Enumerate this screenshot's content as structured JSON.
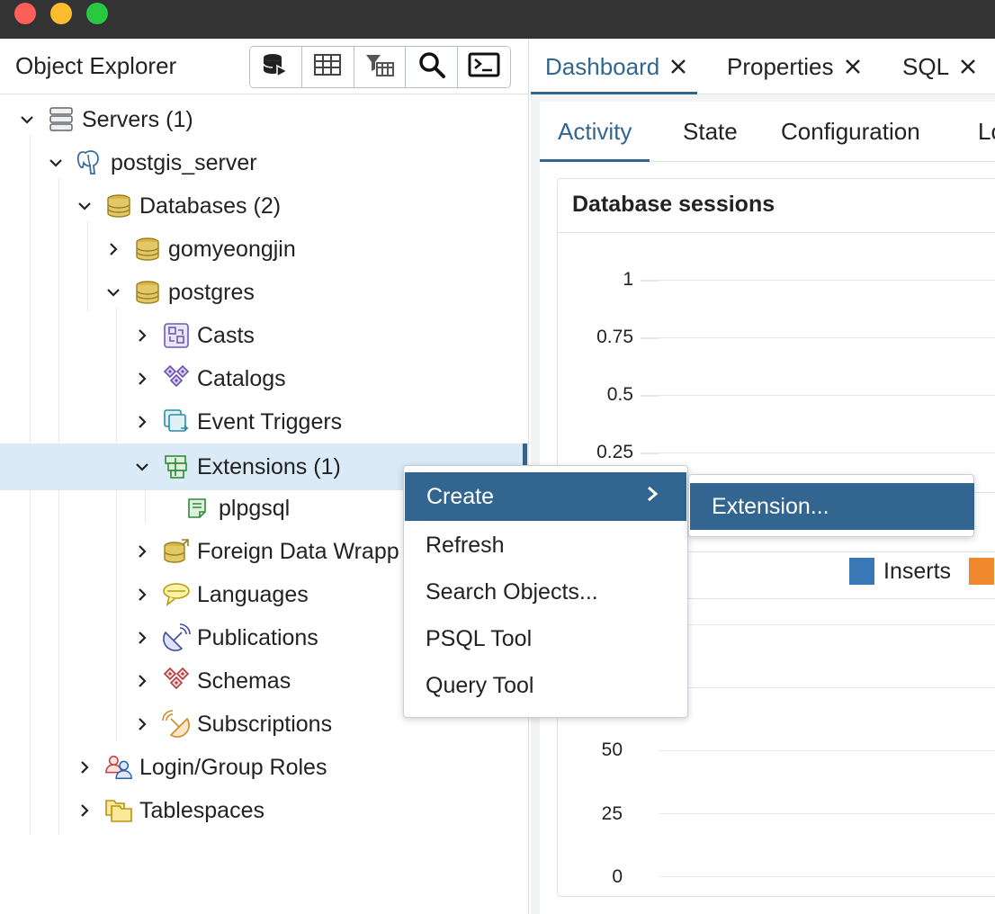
{
  "window": {
    "traffic_lights": [
      "close",
      "minimize",
      "zoom"
    ]
  },
  "explorer": {
    "title": "Object Explorer",
    "toolbar": [
      {
        "name": "query-tool-button",
        "icon": "database-play-icon"
      },
      {
        "name": "view-data-button",
        "icon": "table-icon"
      },
      {
        "name": "filtered-rows-button",
        "icon": "table-filter-icon"
      },
      {
        "name": "search-objects-button",
        "icon": "search-icon"
      },
      {
        "name": "psql-tool-button",
        "icon": "terminal-icon"
      }
    ],
    "tree": {
      "servers": {
        "label": "Servers",
        "count": "(1)"
      },
      "server": {
        "label": "postgis_server"
      },
      "databases": {
        "label": "Databases",
        "count": "(2)"
      },
      "db1": {
        "label": "gomyeongjin"
      },
      "db2": {
        "label": "postgres"
      },
      "casts": {
        "label": "Casts"
      },
      "catalogs": {
        "label": "Catalogs"
      },
      "event_triggers": {
        "label": "Event Triggers"
      },
      "extensions": {
        "label": "Extensions",
        "count": "(1)"
      },
      "plpgsql": {
        "label": "plpgsql"
      },
      "fdw": {
        "label": "Foreign Data Wrapp"
      },
      "languages": {
        "label": "Languages"
      },
      "publications": {
        "label": "Publications"
      },
      "schemas": {
        "label": "Schemas"
      },
      "subscriptions": {
        "label": "Subscriptions"
      },
      "login_roles": {
        "label": "Login/Group Roles"
      },
      "tablespaces": {
        "label": "Tablespaces"
      }
    }
  },
  "tabs": [
    {
      "label": "Dashboard",
      "active": true
    },
    {
      "label": "Properties",
      "active": false
    },
    {
      "label": "SQL",
      "active": false
    }
  ],
  "dashboard": {
    "subtabs": [
      "Activity",
      "State",
      "Configuration",
      "Lo"
    ],
    "sessions_card": {
      "title": "Database sessions",
      "yticks": [
        "1",
        "0.75",
        "0.5",
        "0.25"
      ]
    },
    "tuples_card": {
      "legend": [
        {
          "label": "Inserts",
          "color": "#3a78b5"
        },
        {
          "label": "",
          "color": "#f0882e"
        }
      ],
      "yticks": [
        "50",
        "25",
        "0"
      ]
    }
  },
  "context_menu": {
    "items": [
      "Create",
      "Refresh",
      "Search Objects...",
      "PSQL Tool",
      "Query Tool"
    ],
    "submenu": [
      "Extension..."
    ]
  },
  "colors": {
    "accent": "#326690",
    "selected_row": "#dbeaf7",
    "titlebar": "#333333"
  }
}
